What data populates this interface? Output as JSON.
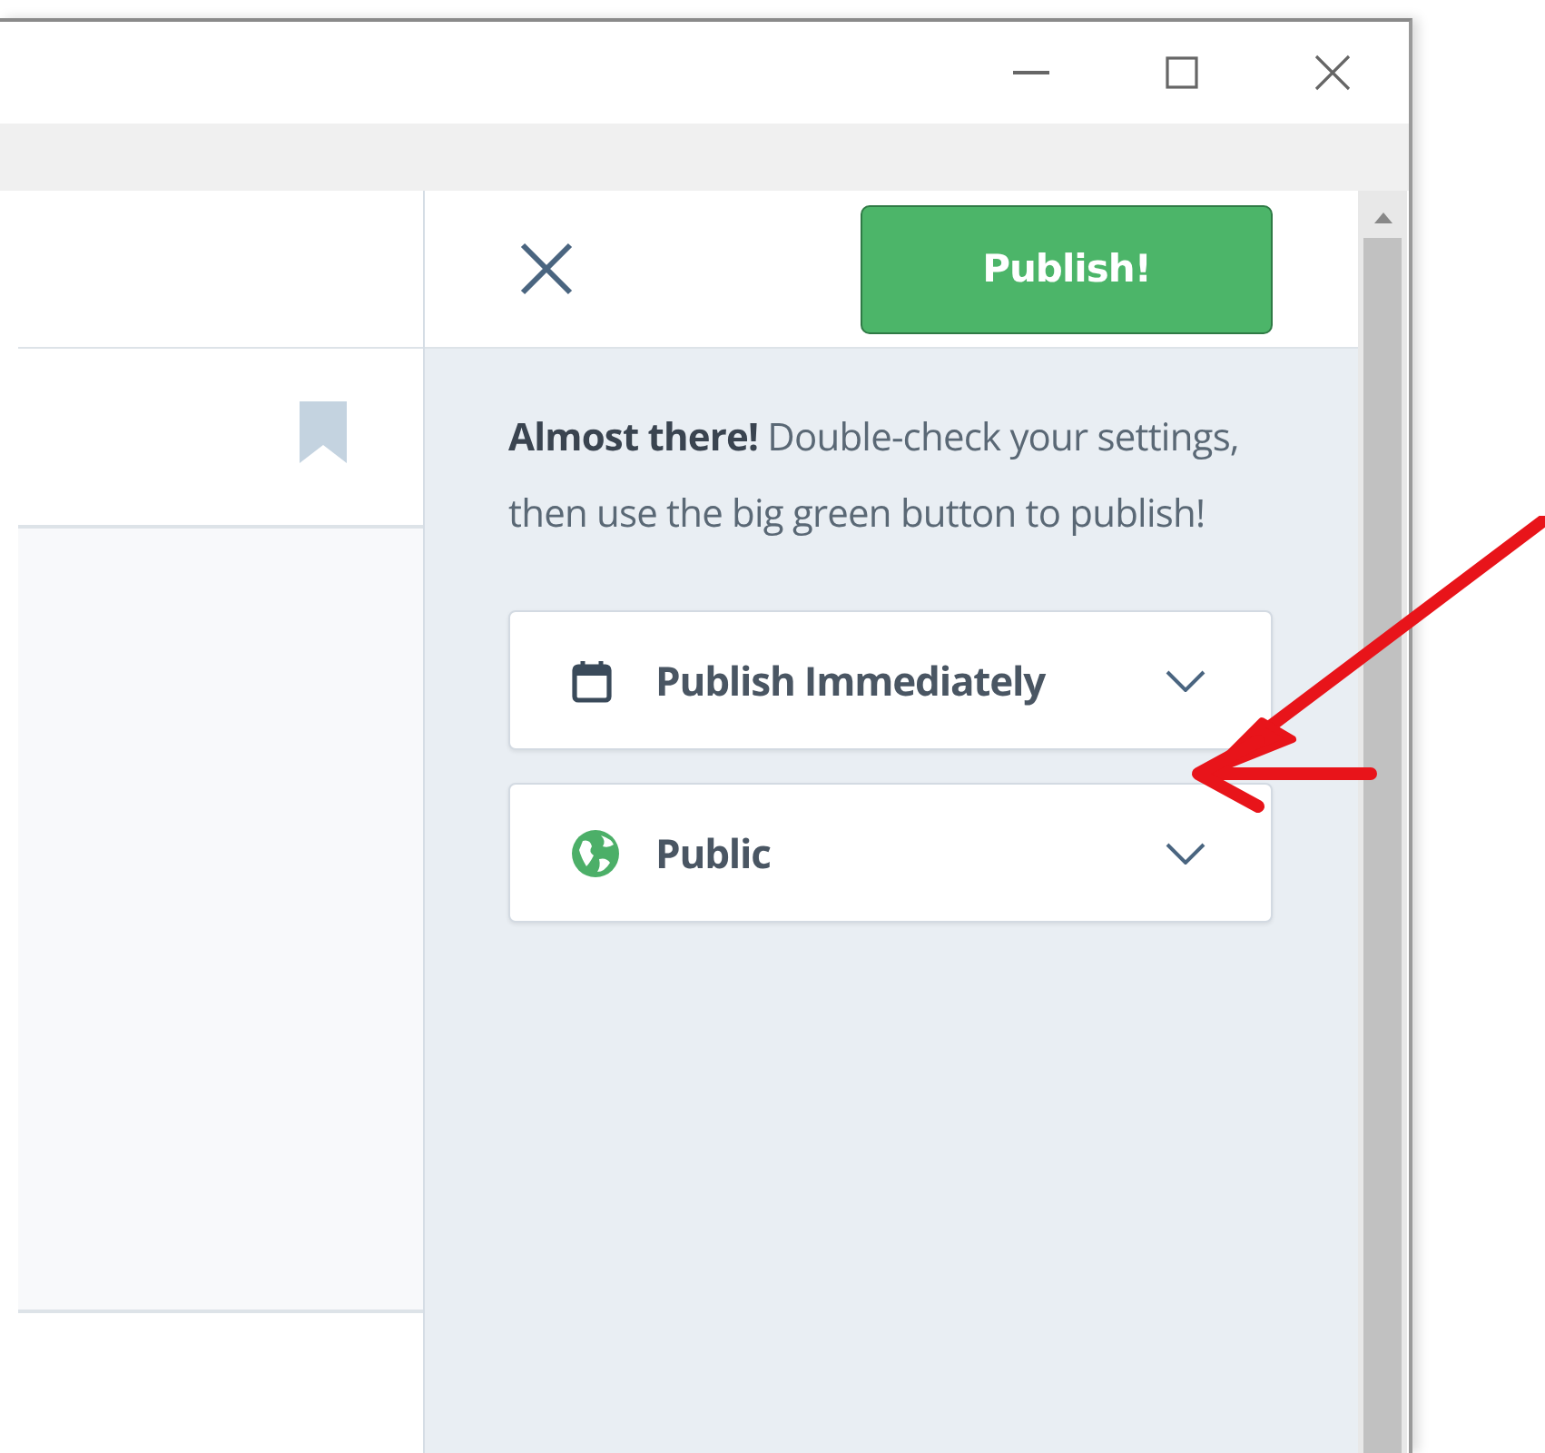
{
  "panel": {
    "publish_button": "Publish!",
    "message": "**Almost there!** Double-check your settings, then use the big green button to publish!",
    "dropdowns": [
      {
        "kind": "calendar",
        "label": "Publish Immediately"
      },
      {
        "kind": "globe",
        "label": "Public"
      }
    ]
  },
  "annotations": [
    {
      "kind": "arrow"
    }
  ]
}
